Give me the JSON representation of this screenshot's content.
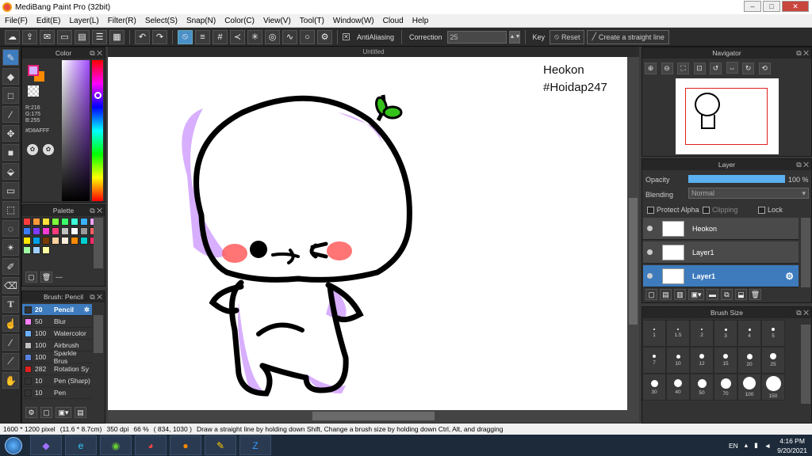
{
  "window": {
    "title": "MediBang Paint Pro (32bit)",
    "minimize": "–",
    "maximize": "□",
    "close": "✕"
  },
  "menu": [
    "File(F)",
    "Edit(E)",
    "Layer(L)",
    "Filter(R)",
    "Select(S)",
    "Snap(N)",
    "Color(C)",
    "View(V)",
    "Tool(T)",
    "Window(W)",
    "Cloud",
    "Help"
  ],
  "toolbar": {
    "antialiasing_label": "AntiAliasing",
    "correction_label": "Correction",
    "correction_value": "25",
    "key_label": "Key",
    "reset_label": "Reset",
    "straight_line_label": "Create a straight line"
  },
  "color_panel": {
    "title": "Color",
    "r": "R:216",
    "g": "G:175",
    "b": "B:255",
    "hex": "#D8AFFF",
    "fg_color": "#d8afff",
    "bg_color": "#ff8a00"
  },
  "palette_panel": {
    "title": "Palette",
    "swatches": [
      "#ff3b3b",
      "#ff9a3b",
      "#ffe13b",
      "#7dff3b",
      "#3bff6a",
      "#3bffd5",
      "#3bb0ff",
      "#f0a0ff",
      "#3b7dff",
      "#7d3bff",
      "#ff3bd5",
      "#ff3b7d",
      "#c0c0c0",
      "#ffffff",
      "#999999",
      "#ff6060",
      "#ffe600",
      "#00a0e9",
      "#7a3b00",
      "#ffd0a0",
      "#ffeedd",
      "#ff8a00",
      "#00d0d0",
      "#ff2a6a",
      "#a0ffa0",
      "#a0d0ff",
      "#ffffa0"
    ],
    "dash": "---"
  },
  "brush_panel": {
    "title": "Brush: Pencil",
    "items": [
      {
        "size": "20",
        "name": "Pencil",
        "color": "#333333"
      },
      {
        "size": "50",
        "name": "Blur",
        "color": "#ff80ff"
      },
      {
        "size": "100",
        "name": "Watercolor",
        "color": "#6ab0ff"
      },
      {
        "size": "100",
        "name": "Airbrush",
        "color": "#c0c0c0"
      },
      {
        "size": "100",
        "name": "Sparkle Brus",
        "color": "#5a80e0"
      },
      {
        "size": "282",
        "name": "Rotation Sy",
        "color": "#e02020"
      },
      {
        "size": "10",
        "name": "Pen (Sharp)",
        "color": "#333333"
      },
      {
        "size": "10",
        "name": "Pen",
        "color": "#333333"
      }
    ]
  },
  "canvas": {
    "tab_title": "Untitled",
    "text_line1": "Heokon",
    "text_line2": "#Hoidap247"
  },
  "status": {
    "pixels": "1600 * 1200 pixel",
    "size_cm": "(11.6 * 8.7cm)",
    "dpi": "350 dpi",
    "zoom": "66 %",
    "coords": "( 834, 1030 )",
    "hint": "Draw a straight line by holding down Shift, Change a brush size by holding down Ctrl, Alt, and dragging"
  },
  "navigator": {
    "title": "Navigator"
  },
  "layer_panel": {
    "title": "Layer",
    "opacity_label": "Opacity",
    "opacity_value": "100 %",
    "opacity": 1.0,
    "blending_label": "Blending",
    "blending_value": "Normal",
    "protect_alpha": "Protect Alpha",
    "clipping": "Clipping",
    "lock": "Lock",
    "layers": [
      {
        "name": "Heokon"
      },
      {
        "name": "Layer1"
      },
      {
        "name": "Layer1"
      }
    ]
  },
  "brush_size_panel": {
    "title": "Brush Size",
    "sizes": [
      "1",
      "1.5",
      "2",
      "3",
      "4",
      "5",
      "7",
      "10",
      "12",
      "15",
      "20",
      "25",
      "30",
      "40",
      "50",
      "70",
      "100",
      "150"
    ]
  },
  "taskbar": {
    "lang": "EN",
    "time": "4:16 PM",
    "date": "9/20/2021"
  }
}
